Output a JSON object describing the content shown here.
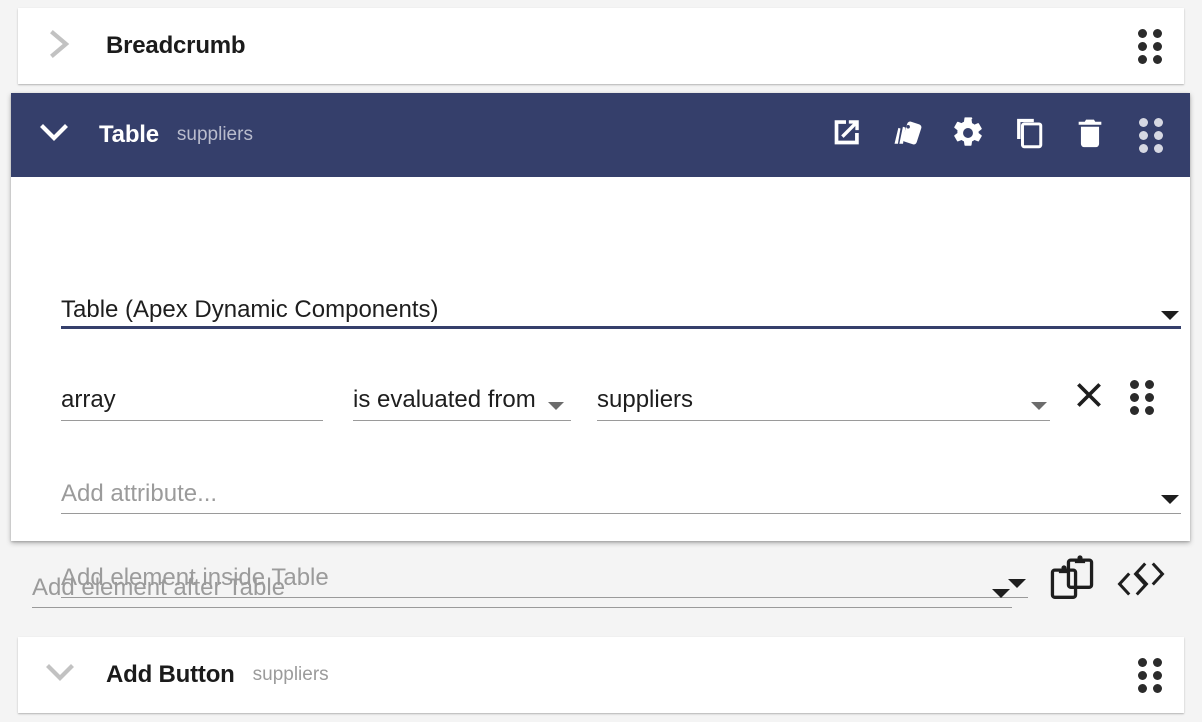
{
  "breadcrumb": {
    "title": "Breadcrumb",
    "chevron_icon": "chevron-right-icon",
    "drag_icon": "drag-handle-icon"
  },
  "table_card": {
    "header": {
      "chevron_icon": "chevron-down-icon",
      "title": "Table",
      "subtitle": "suppliers",
      "accent_color": "#353f6b",
      "actions": [
        {
          "name": "open-in-new-icon",
          "label": "Open in new window"
        },
        {
          "name": "style-palette-icon",
          "label": "Styles"
        },
        {
          "name": "gear-icon",
          "label": "Settings"
        },
        {
          "name": "copy-icon",
          "label": "Duplicate"
        },
        {
          "name": "trash-icon",
          "label": "Delete"
        },
        {
          "name": "drag-handle-icon",
          "label": "Drag to reorder"
        }
      ]
    },
    "type_select": {
      "value": "Table (Apex Dynamic Components)",
      "caret_icon": "chevron-down-icon"
    },
    "attribute_row": {
      "name": "array",
      "operator": "is evaluated from",
      "operator_caret_icon": "chevron-down-icon",
      "value": "suppliers",
      "value_caret_icon": "chevron-down-icon",
      "remove_icon": "close-icon",
      "drag_icon": "drag-handle-icon"
    },
    "add_attribute": {
      "placeholder": "Add attribute...",
      "caret_icon": "chevron-down-icon"
    },
    "add_element_inside": {
      "placeholder": "Add element inside Table",
      "caret_icon": "chevron-down-icon",
      "paste_icon": "clipboard-paste-icon",
      "code_icon": "code-brackets-icon"
    }
  },
  "add_element_after": {
    "placeholder": "Add element after Table",
    "caret_icon": "chevron-down-icon",
    "paste_icon": "clipboard-paste-icon",
    "code_icon": "code-brackets-icon"
  },
  "add_button_card": {
    "chevron_icon": "chevron-down-icon",
    "title": "Add Button",
    "subtitle": "suppliers",
    "drag_icon": "drag-handle-icon"
  }
}
